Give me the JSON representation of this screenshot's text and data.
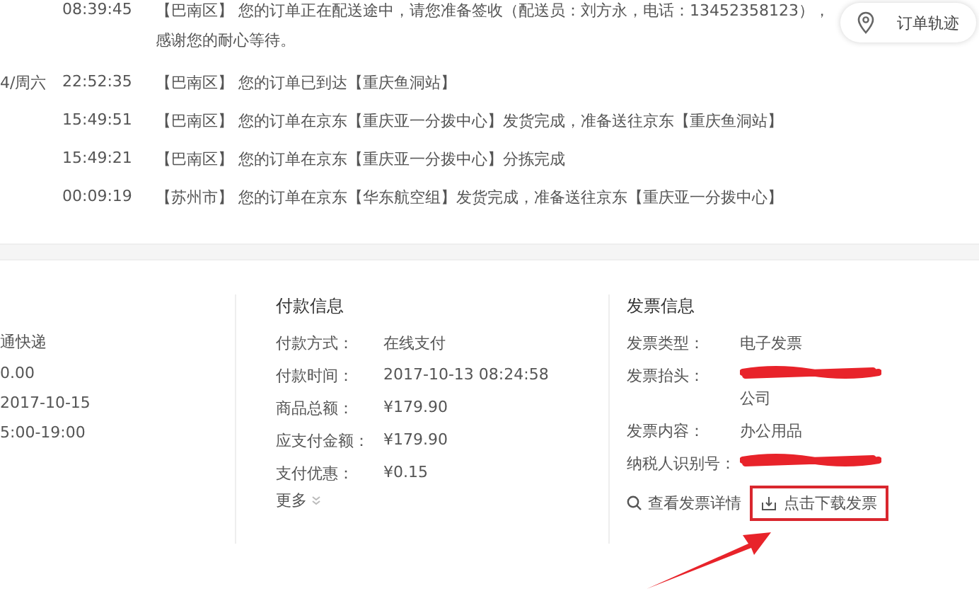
{
  "tracking": {
    "button": "订单轨迹",
    "rows": [
      {
        "date": "",
        "time": "08:39:45",
        "lines": [
          "【巴南区】 您的订单正在配送途中，请您准备签收（配送员：刘方永，电话：13452358123），",
          "感谢您的耐心等待。"
        ]
      },
      {
        "date": "4/周六",
        "time": "22:52:35",
        "lines": [
          "【巴南区】 您的订单已到达【重庆鱼洞站】"
        ]
      },
      {
        "date": "",
        "time": "15:49:51",
        "lines": [
          "【巴南区】 您的订单在京东【重庆亚一分拨中心】发货完成，准备送往京东【重庆鱼洞站】"
        ]
      },
      {
        "date": "",
        "time": "15:49:21",
        "lines": [
          "【巴南区】 您的订单在京东【重庆亚一分拨中心】分拣完成"
        ]
      },
      {
        "date": "",
        "time": "00:09:19",
        "lines": [
          "【苏州市】 您的订单在京东【华东航空组】发货完成，准备送往京东【重庆亚一分拨中心】"
        ]
      }
    ]
  },
  "delivery": {
    "values": [
      "通快递",
      "0.00",
      "2017-10-15",
      "5:00-19:00"
    ]
  },
  "payment": {
    "title": "付款信息",
    "rows": [
      {
        "label": "付款方式：",
        "value": "在线支付"
      },
      {
        "label": "付款时间：",
        "value": "2017-10-13 08:24:58"
      },
      {
        "label": "商品总额：",
        "value": "¥179.90"
      },
      {
        "label": "应支付金额：",
        "value": "¥179.90"
      },
      {
        "label": "支付优惠：",
        "value": "¥0.15"
      }
    ],
    "more": "更多"
  },
  "invoice": {
    "title": "发票信息",
    "rows": [
      {
        "label": "发票类型：",
        "value": "电子发票",
        "redacted": false
      },
      {
        "label": "发票抬头：",
        "value": "公司",
        "redacted": true
      },
      {
        "label": "发票内容：",
        "value": "办公用品",
        "redacted": false
      },
      {
        "label": "纳税人识别号：",
        "value": "",
        "redacted": true
      }
    ],
    "view_link": "查看发票详情",
    "download_button": "点击下载发票",
    "download_highlighted": true
  }
}
